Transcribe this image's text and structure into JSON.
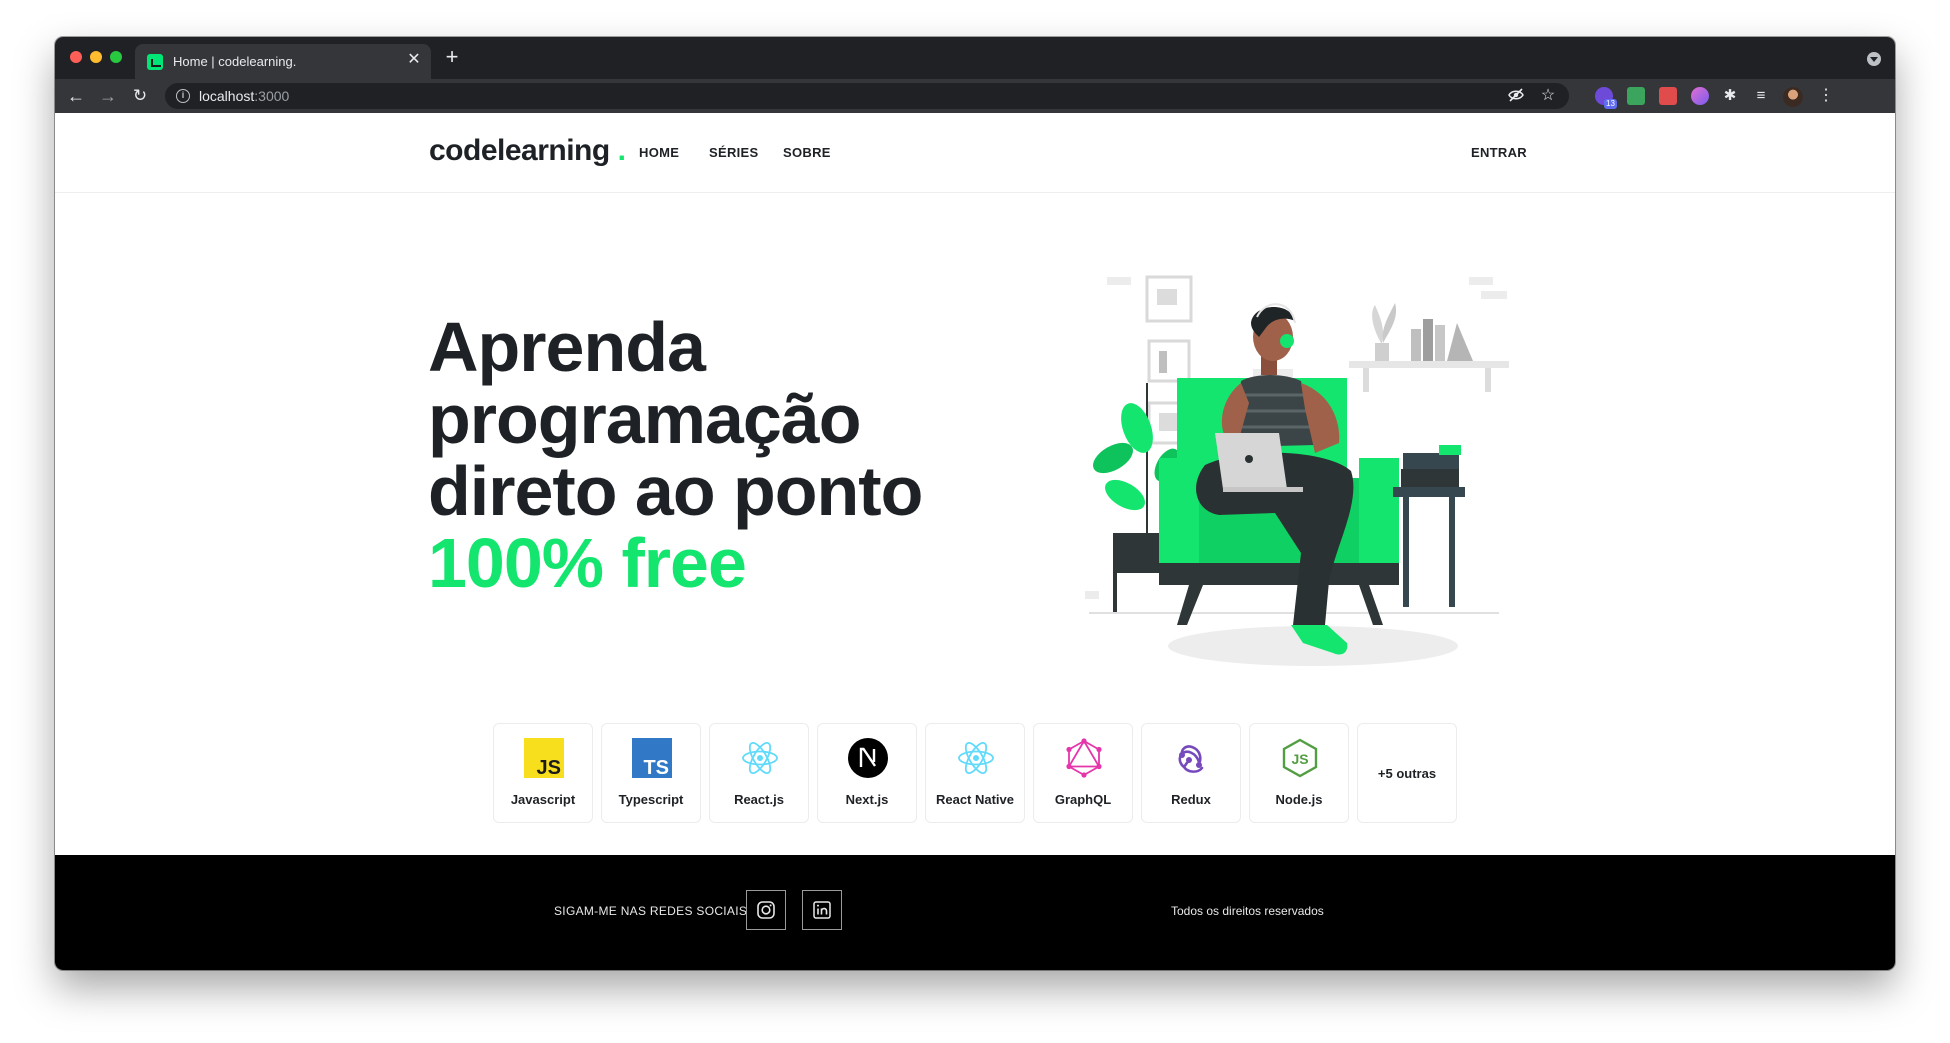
{
  "browser": {
    "tab_title": "Home | codelearning.",
    "tab_close": "✕",
    "new_tab": "+",
    "url_host": "localhost",
    "url_port": ":3000",
    "extension_badge": "13"
  },
  "header": {
    "logo_text": "codelearning",
    "logo_dot": ".",
    "nav": {
      "home": "HOME",
      "series": "SÉRIES",
      "sobre": "SOBRE"
    },
    "login": "ENTRAR"
  },
  "hero": {
    "line1": "Aprenda",
    "line2": "programação",
    "line3": "direto ao ponto",
    "line4": "100% free"
  },
  "techs": [
    {
      "label": "Javascript",
      "icon": "javascript-icon"
    },
    {
      "label": "Typescript",
      "icon": "typescript-icon"
    },
    {
      "label": "React.js",
      "icon": "react-icon"
    },
    {
      "label": "Next.js",
      "icon": "nextjs-icon"
    },
    {
      "label": "React Native",
      "icon": "react-native-icon"
    },
    {
      "label": "GraphQL",
      "icon": "graphql-icon"
    },
    {
      "label": "Redux",
      "icon": "redux-icon"
    },
    {
      "label": "Node.js",
      "icon": "nodejs-icon"
    }
  ],
  "techs_more": "+5 outras",
  "footer": {
    "social_label": "SIGAM-ME NAS REDES SOCIAIS",
    "rights": "Todos os direitos reservados"
  },
  "colors": {
    "brand_green": "#14e56e",
    "text_dark": "#1e2125",
    "footer_bg": "#000000"
  }
}
